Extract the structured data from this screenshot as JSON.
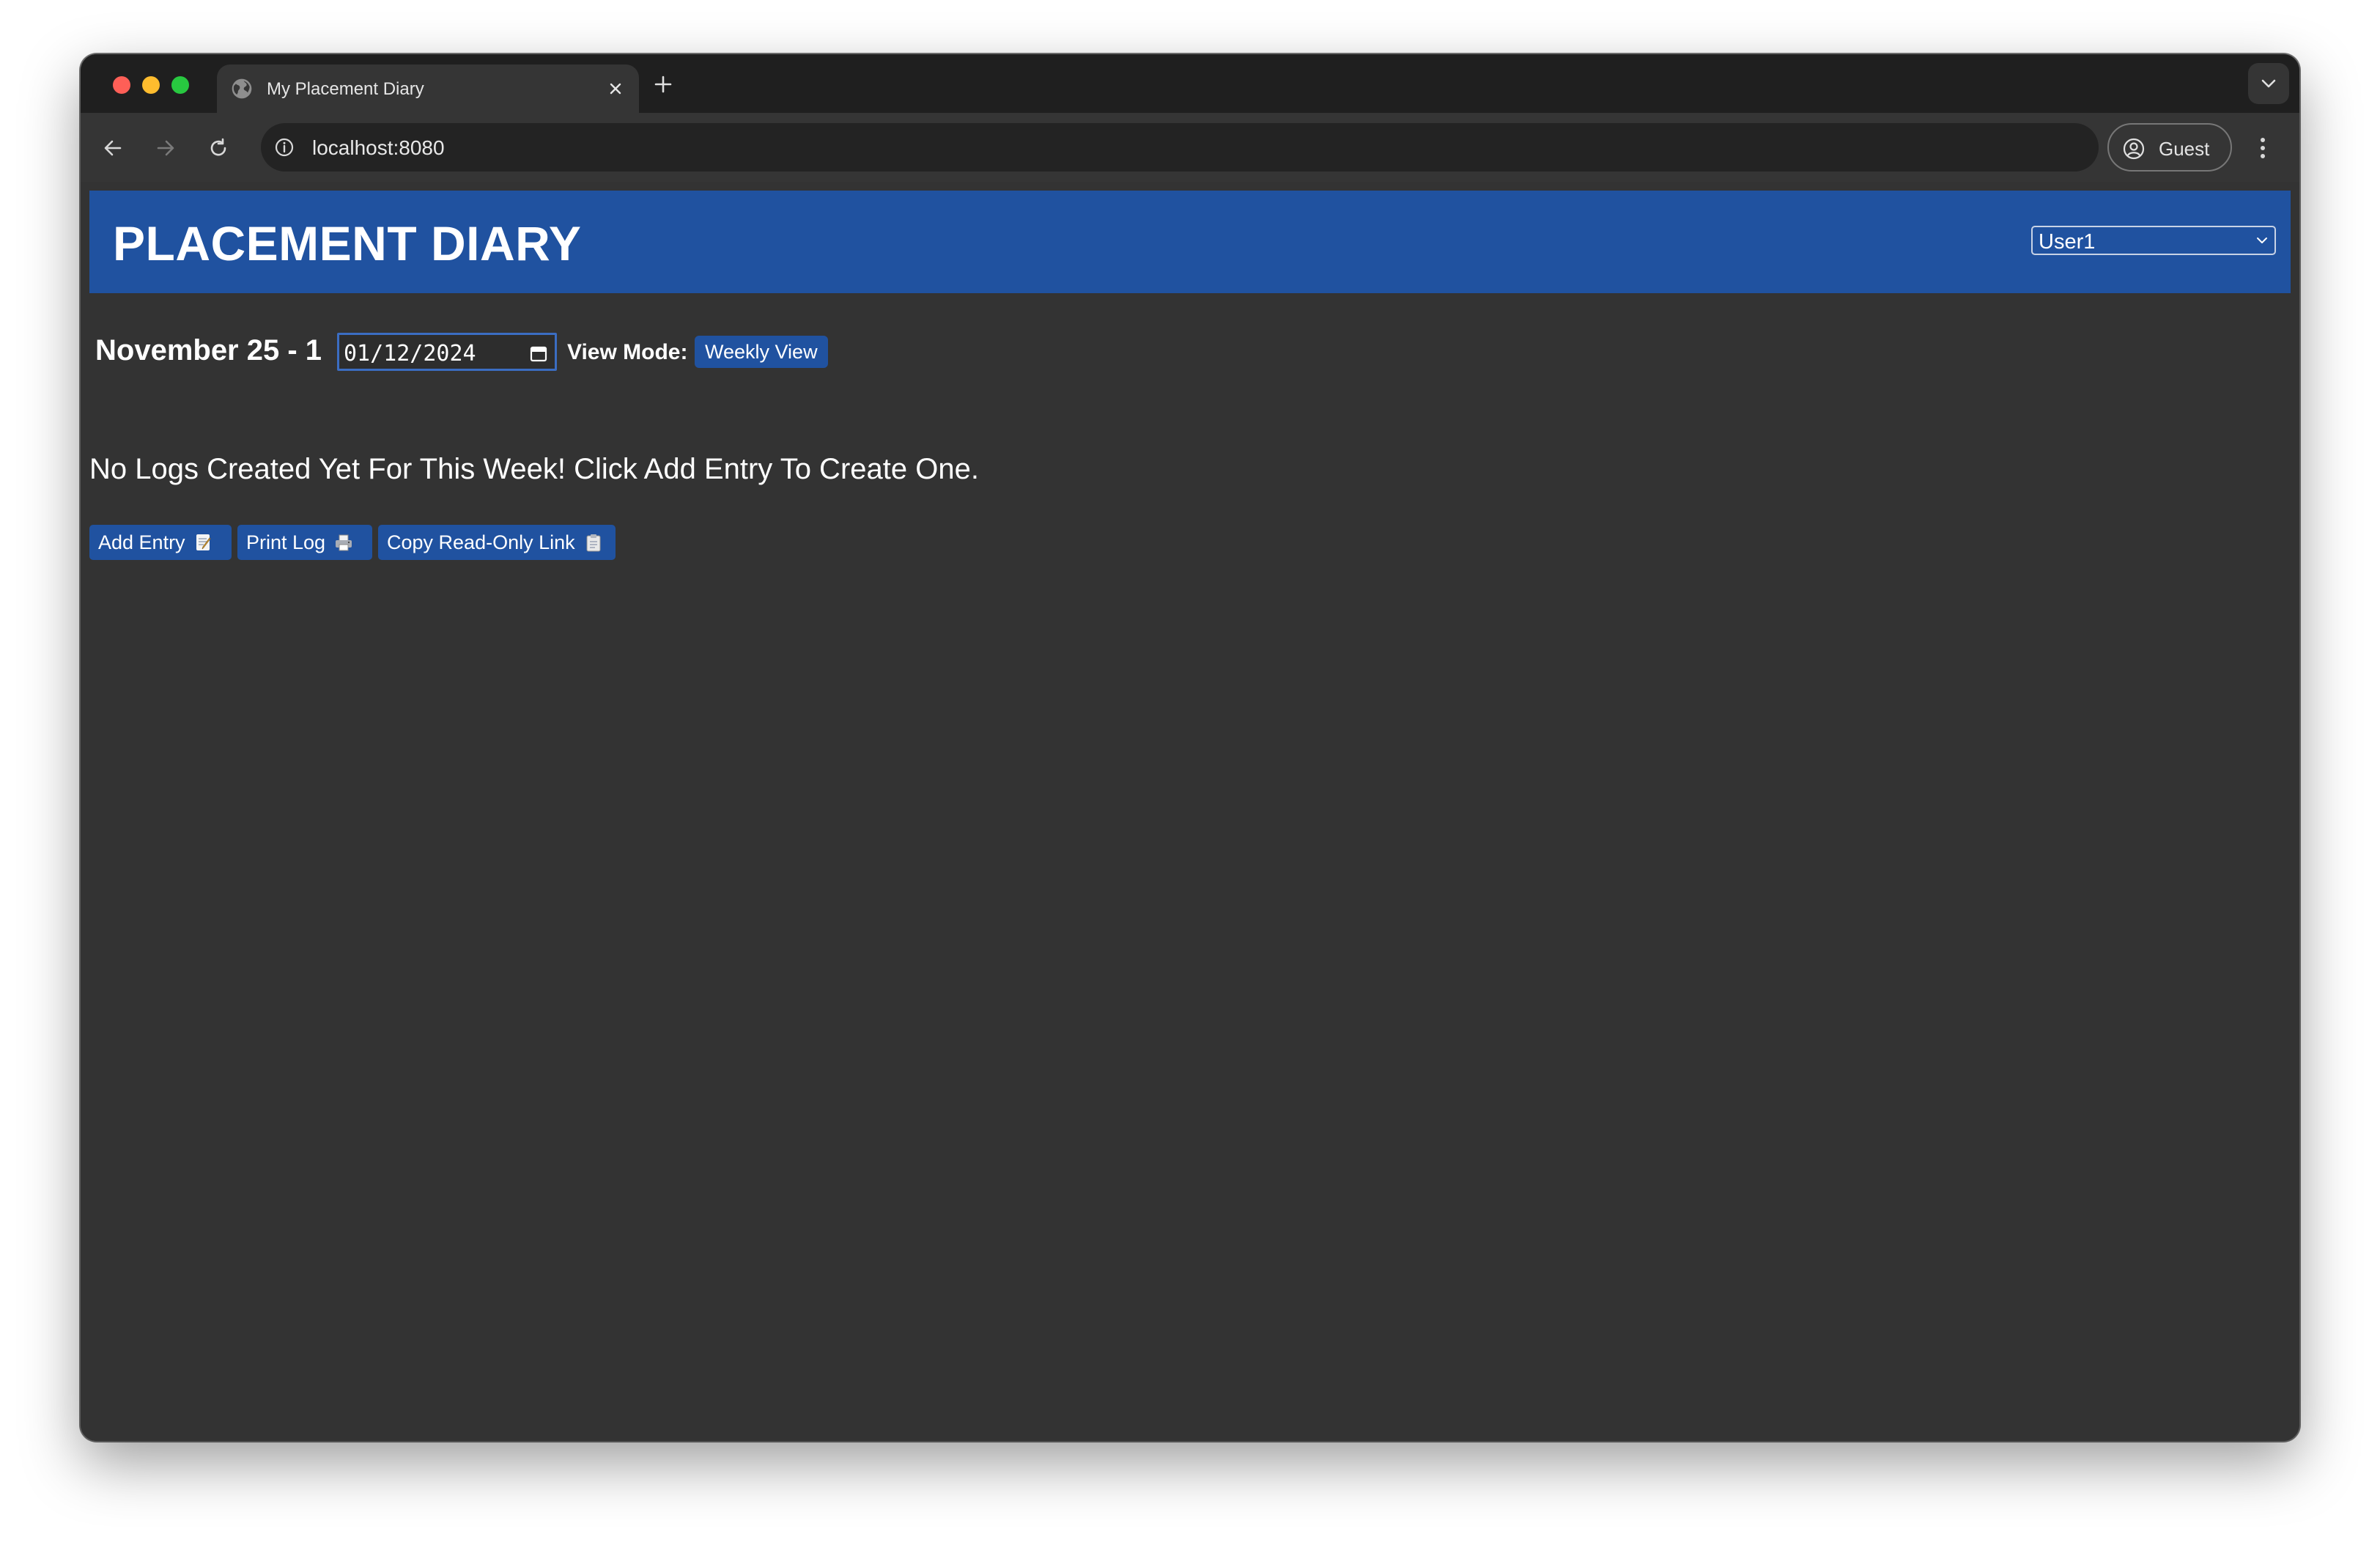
{
  "browser": {
    "tab_title": "My Placement Diary",
    "url": "localhost:8080",
    "profile_label": "Guest"
  },
  "app": {
    "title": "PLACEMENT DIARY",
    "user_select": {
      "selected": "User1"
    },
    "week_label": "November 25 - 1",
    "date_value": "01/12/2024",
    "view_mode_label": "View Mode:",
    "view_mode_button": "Weekly View",
    "empty_message": "No Logs Created Yet For This Week! Click Add Entry To Create One.",
    "actions": {
      "add_entry": "Add Entry",
      "print_log": "Print Log",
      "copy_link": "Copy Read-Only Link"
    }
  },
  "colors": {
    "accent": "#2052a0",
    "page_background": "#333333",
    "chrome_dark": "#1f1f1f",
    "chrome_toolbar": "#353535"
  },
  "icons": [
    "globe-icon",
    "close-icon",
    "plus-icon",
    "chevron-down-icon",
    "back-arrow-icon",
    "forward-arrow-icon",
    "reload-icon",
    "info-icon",
    "profile-icon",
    "kebab-menu-icon",
    "calendar-icon",
    "memo-icon",
    "printer-icon",
    "clipboard-icon"
  ]
}
